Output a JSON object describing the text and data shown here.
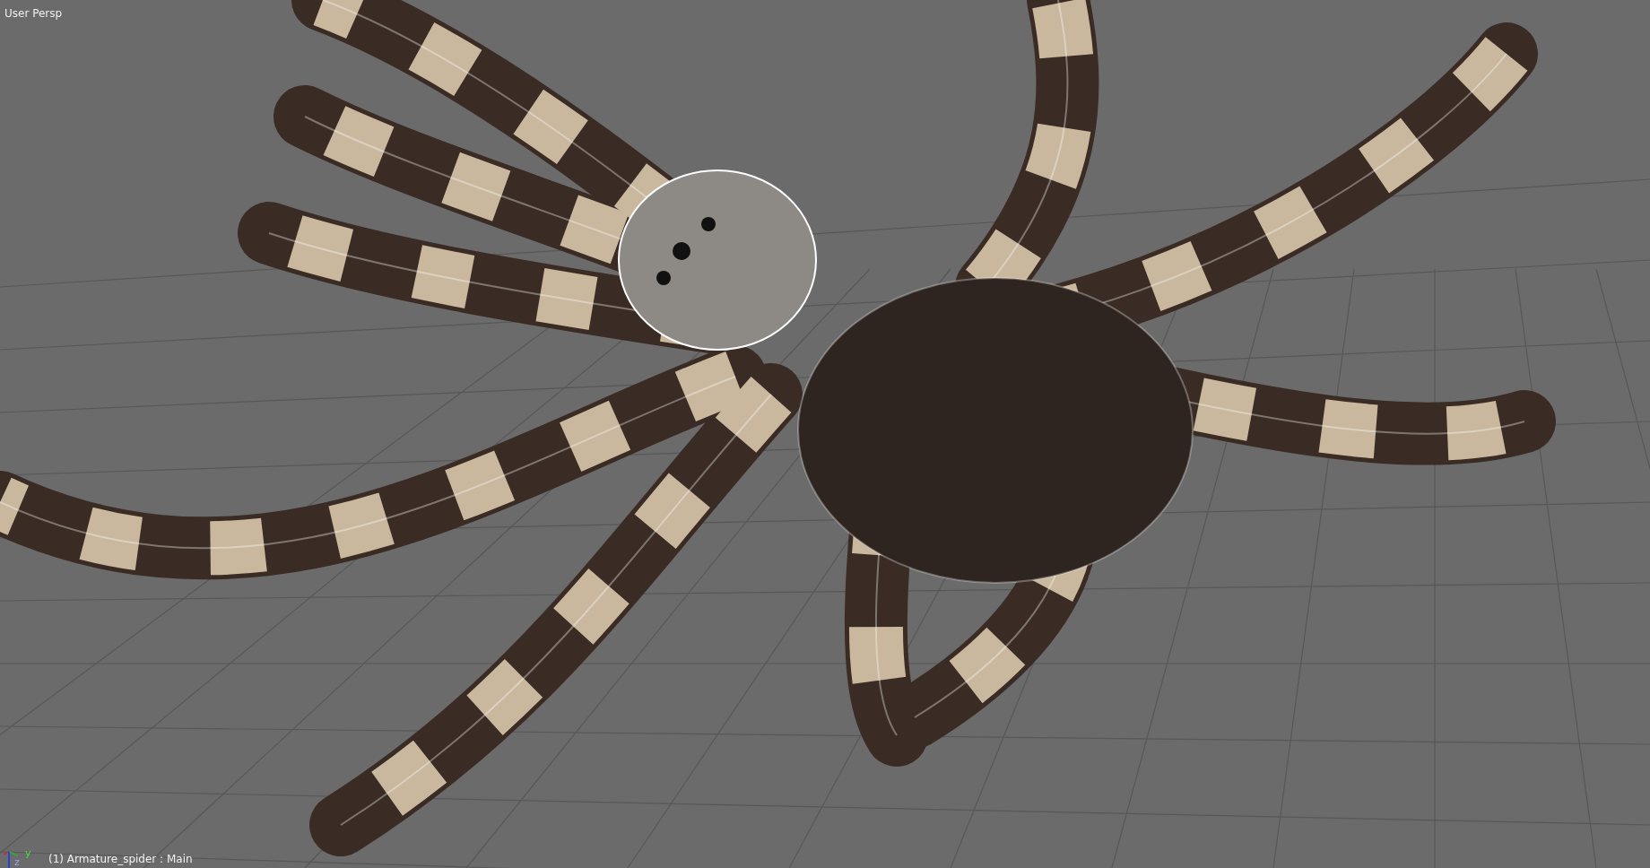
{
  "viewport": {
    "view_label": "User Persp",
    "object_info": "(1) Armature_spider : Main",
    "axis_labels": [
      "y",
      "z"
    ]
  }
}
